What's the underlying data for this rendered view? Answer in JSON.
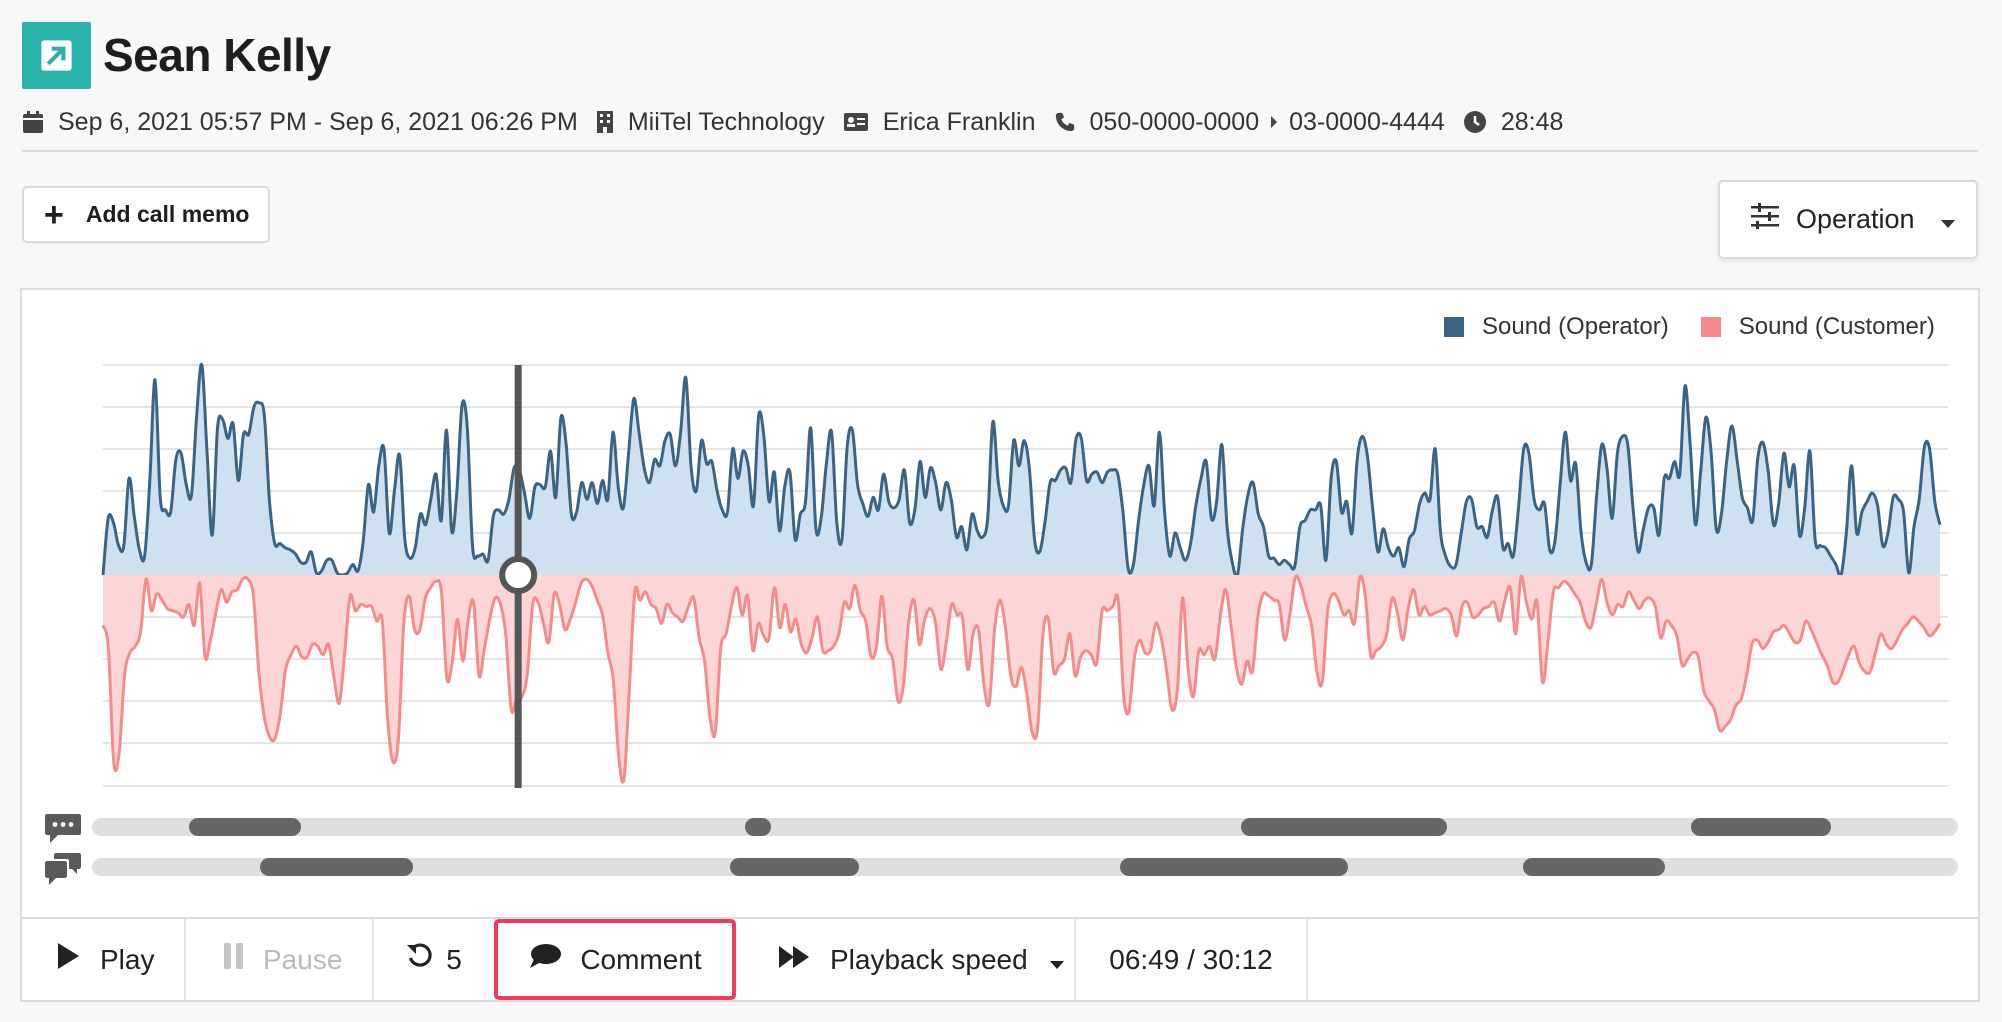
{
  "header": {
    "title": "Sean Kelly",
    "title_icon": "external-link-icon",
    "accent_color": "#29b3ac"
  },
  "meta": {
    "datetime": "Sep 6, 2021 05:57 PM - Sep 6, 2021 06:26 PM",
    "company": "MiiTel Technology",
    "user": "Erica Franklin",
    "phone_from": "050-0000-0000",
    "phone_to": "03-0000-4444",
    "duration": "28:48",
    "icons": [
      "calendar-icon",
      "building-icon",
      "id-card-icon",
      "phone-icon",
      "caret-right-icon",
      "clock-icon"
    ]
  },
  "toolbar": {
    "add_memo_label": "Add call memo",
    "operation_label": "Operation"
  },
  "chart_data": {
    "type": "area",
    "y_axis_labels": "none",
    "grid": "horizontal lines",
    "legend_position": "top-right",
    "series": [
      {
        "name": "Sound (Operator)",
        "color": "#3d6383",
        "fill": "#cfe0f0",
        "values": [
          0.0,
          0.27,
          0.25,
          0.14,
          0.14,
          0.46,
          0.28,
          0.12,
          0.09,
          0.45,
          0.93,
          0.37,
          0.31,
          0.3,
          0.55,
          0.58,
          0.43,
          0.38,
          0.76,
          1.0,
          0.58,
          0.19,
          0.7,
          0.74,
          0.65,
          0.72,
          0.45,
          0.67,
          0.67,
          0.8,
          0.82,
          0.76,
          0.35,
          0.15,
          0.15,
          0.13,
          0.12,
          0.1,
          0.06,
          0.06,
          0.11,
          0.01,
          0.02,
          0.07,
          0.07,
          0.01,
          0.0,
          0.01,
          0.05,
          0.02,
          0.16,
          0.43,
          0.3,
          0.52,
          0.6,
          0.2,
          0.4,
          0.57,
          0.17,
          0.08,
          0.13,
          0.29,
          0.24,
          0.36,
          0.48,
          0.26,
          0.69,
          0.21,
          0.4,
          0.81,
          0.7,
          0.14,
          0.09,
          0.1,
          0.07,
          0.28,
          0.31,
          0.29,
          0.36,
          0.51,
          0.5,
          0.39,
          0.27,
          0.42,
          0.43,
          0.42,
          0.59,
          0.37,
          0.75,
          0.62,
          0.29,
          0.3,
          0.44,
          0.36,
          0.44,
          0.34,
          0.45,
          0.36,
          0.68,
          0.42,
          0.32,
          0.58,
          0.84,
          0.68,
          0.51,
          0.44,
          0.55,
          0.52,
          0.64,
          0.67,
          0.52,
          0.68,
          0.94,
          0.52,
          0.4,
          0.64,
          0.53,
          0.54,
          0.4,
          0.31,
          0.3,
          0.6,
          0.46,
          0.59,
          0.52,
          0.33,
          0.76,
          0.66,
          0.35,
          0.49,
          0.21,
          0.42,
          0.49,
          0.17,
          0.29,
          0.35,
          0.7,
          0.22,
          0.27,
          0.53,
          0.68,
          0.25,
          0.17,
          0.61,
          0.69,
          0.43,
          0.34,
          0.28,
          0.37,
          0.31,
          0.48,
          0.35,
          0.32,
          0.36,
          0.5,
          0.25,
          0.31,
          0.54,
          0.37,
          0.51,
          0.44,
          0.31,
          0.44,
          0.36,
          0.18,
          0.23,
          0.12,
          0.29,
          0.21,
          0.18,
          0.27,
          0.73,
          0.45,
          0.33,
          0.33,
          0.64,
          0.52,
          0.64,
          0.51,
          0.17,
          0.11,
          0.25,
          0.44,
          0.45,
          0.5,
          0.51,
          0.44,
          0.65,
          0.65,
          0.45,
          0.48,
          0.49,
          0.44,
          0.49,
          0.5,
          0.48,
          0.3,
          0.03,
          0.05,
          0.26,
          0.43,
          0.52,
          0.33,
          0.68,
          0.3,
          0.09,
          0.2,
          0.13,
          0.07,
          0.15,
          0.33,
          0.46,
          0.54,
          0.27,
          0.35,
          0.62,
          0.23,
          0.06,
          0.0,
          0.22,
          0.38,
          0.44,
          0.29,
          0.23,
          0.09,
          0.08,
          0.05,
          0.07,
          0.05,
          0.04,
          0.23,
          0.26,
          0.31,
          0.31,
          0.33,
          0.07,
          0.46,
          0.54,
          0.3,
          0.35,
          0.2,
          0.55,
          0.66,
          0.56,
          0.31,
          0.11,
          0.22,
          0.13,
          0.09,
          0.13,
          0.04,
          0.17,
          0.21,
          0.34,
          0.39,
          0.36,
          0.6,
          0.21,
          0.09,
          0.04,
          0.05,
          0.2,
          0.35,
          0.36,
          0.23,
          0.23,
          0.18,
          0.31,
          0.37,
          0.13,
          0.15,
          0.09,
          0.32,
          0.6,
          0.58,
          0.36,
          0.31,
          0.34,
          0.12,
          0.16,
          0.43,
          0.68,
          0.45,
          0.53,
          0.21,
          0.06,
          0.05,
          0.37,
          0.62,
          0.51,
          0.27,
          0.58,
          0.66,
          0.62,
          0.32,
          0.11,
          0.22,
          0.32,
          0.32,
          0.19,
          0.46,
          0.46,
          0.54,
          0.48,
          0.9,
          0.62,
          0.24,
          0.49,
          0.75,
          0.59,
          0.22,
          0.29,
          0.54,
          0.71,
          0.55,
          0.37,
          0.32,
          0.26,
          0.56,
          0.63,
          0.49,
          0.24,
          0.34,
          0.58,
          0.42,
          0.52,
          0.19,
          0.32,
          0.59,
          0.17,
          0.14,
          0.13,
          0.09,
          0.05,
          0.0,
          0.2,
          0.52,
          0.2,
          0.3,
          0.35,
          0.39,
          0.33,
          0.14,
          0.2,
          0.37,
          0.36,
          0.3,
          0.01,
          0.23,
          0.36,
          0.61,
          0.6,
          0.35,
          0.24
        ]
      },
      {
        "name": "Sound (Customer)",
        "color": "#f58c8c",
        "fill": "#fcd6d6",
        "values": [
          0.24,
          0.35,
          0.89,
          0.85,
          0.48,
          0.37,
          0.34,
          0.27,
          0.02,
          0.17,
          0.09,
          0.12,
          0.16,
          0.17,
          0.18,
          0.2,
          0.14,
          0.24,
          0.04,
          0.39,
          0.31,
          0.18,
          0.07,
          0.13,
          0.08,
          0.07,
          0.02,
          0.02,
          0.1,
          0.46,
          0.67,
          0.77,
          0.78,
          0.66,
          0.45,
          0.38,
          0.34,
          0.39,
          0.39,
          0.33,
          0.34,
          0.38,
          0.33,
          0.49,
          0.61,
          0.37,
          0.1,
          0.17,
          0.14,
          0.15,
          0.15,
          0.22,
          0.22,
          0.69,
          0.89,
          0.78,
          0.23,
          0.1,
          0.26,
          0.26,
          0.11,
          0.06,
          0.03,
          0.08,
          0.49,
          0.42,
          0.21,
          0.41,
          0.21,
          0.13,
          0.48,
          0.35,
          0.21,
          0.11,
          0.14,
          0.29,
          0.64,
          0.59,
          0.58,
          0.47,
          0.14,
          0.13,
          0.23,
          0.32,
          0.09,
          0.14,
          0.26,
          0.21,
          0.13,
          0.04,
          0.02,
          0.05,
          0.12,
          0.19,
          0.37,
          0.5,
          0.86,
          0.97,
          0.54,
          0.08,
          0.12,
          0.08,
          0.14,
          0.16,
          0.23,
          0.14,
          0.18,
          0.2,
          0.22,
          0.15,
          0.11,
          0.3,
          0.41,
          0.68,
          0.75,
          0.35,
          0.28,
          0.15,
          0.06,
          0.19,
          0.1,
          0.36,
          0.23,
          0.29,
          0.3,
          0.06,
          0.25,
          0.14,
          0.27,
          0.21,
          0.33,
          0.37,
          0.3,
          0.2,
          0.36,
          0.36,
          0.34,
          0.28,
          0.13,
          0.16,
          0.05,
          0.17,
          0.22,
          0.39,
          0.34,
          0.1,
          0.34,
          0.4,
          0.6,
          0.53,
          0.22,
          0.12,
          0.33,
          0.21,
          0.16,
          0.23,
          0.45,
          0.32,
          0.14,
          0.19,
          0.2,
          0.45,
          0.28,
          0.26,
          0.52,
          0.61,
          0.26,
          0.12,
          0.25,
          0.48,
          0.53,
          0.44,
          0.57,
          0.75,
          0.73,
          0.28,
          0.21,
          0.46,
          0.43,
          0.4,
          0.28,
          0.48,
          0.39,
          0.36,
          0.38,
          0.42,
          0.17,
          0.17,
          0.15,
          0.12,
          0.57,
          0.65,
          0.4,
          0.31,
          0.37,
          0.36,
          0.23,
          0.3,
          0.45,
          0.64,
          0.55,
          0.11,
          0.44,
          0.58,
          0.36,
          0.38,
          0.34,
          0.4,
          0.2,
          0.07,
          0.24,
          0.44,
          0.52,
          0.41,
          0.46,
          0.2,
          0.09,
          0.1,
          0.12,
          0.14,
          0.31,
          0.18,
          0.01,
          0.05,
          0.15,
          0.24,
          0.46,
          0.51,
          0.17,
          0.09,
          0.12,
          0.19,
          0.17,
          0.23,
          0.01,
          0.1,
          0.38,
          0.36,
          0.34,
          0.28,
          0.11,
          0.18,
          0.31,
          0.16,
          0.07,
          0.19,
          0.15,
          0.19,
          0.18,
          0.17,
          0.16,
          0.19,
          0.29,
          0.15,
          0.13,
          0.2,
          0.19,
          0.16,
          0.15,
          0.13,
          0.22,
          0.12,
          0.06,
          0.28,
          0.01,
          0.13,
          0.21,
          0.13,
          0.51,
          0.32,
          0.08,
          0.06,
          0.03,
          0.05,
          0.09,
          0.13,
          0.22,
          0.25,
          0.14,
          0.02,
          0.13,
          0.19,
          0.14,
          0.15,
          0.08,
          0.12,
          0.16,
          0.12,
          0.11,
          0.15,
          0.3,
          0.22,
          0.24,
          0.29,
          0.43,
          0.4,
          0.37,
          0.39,
          0.55,
          0.6,
          0.64,
          0.74,
          0.72,
          0.69,
          0.62,
          0.59,
          0.48,
          0.33,
          0.31,
          0.35,
          0.32,
          0.27,
          0.26,
          0.24,
          0.28,
          0.32,
          0.31,
          0.22,
          0.26,
          0.32,
          0.38,
          0.43,
          0.51,
          0.51,
          0.45,
          0.38,
          0.34,
          0.42,
          0.46,
          0.46,
          0.37,
          0.28,
          0.33,
          0.35,
          0.31,
          0.26,
          0.23,
          0.2,
          0.22,
          0.25,
          0.29,
          0.27,
          0.23
        ]
      }
    ],
    "playhead_fraction": 0.226
  },
  "legend": [
    {
      "label": "Sound (Operator)",
      "color": "#3d6383"
    },
    {
      "label": "Sound (Customer)",
      "color": "#f58c8c"
    }
  ],
  "tracks": {
    "comment_icon": "comment-dots-icon",
    "talk_icon": "comments-icon",
    "comment_segments": [
      [
        0.052,
        0.112
      ],
      [
        0.35,
        0.364
      ],
      [
        0.616,
        0.726
      ],
      [
        0.857,
        0.932
      ]
    ],
    "talk_segments": [
      [
        0.09,
        0.172
      ],
      [
        0.342,
        0.411
      ],
      [
        0.551,
        0.673
      ],
      [
        0.767,
        0.843
      ]
    ]
  },
  "controls": {
    "play_label": "Play",
    "pause_label": "Pause",
    "rewind_label": "5",
    "comment_label": "Comment",
    "speed_label": "Playback speed",
    "time_label": "06:49 / 30:12",
    "highlight_color": "#ee3a5e"
  }
}
